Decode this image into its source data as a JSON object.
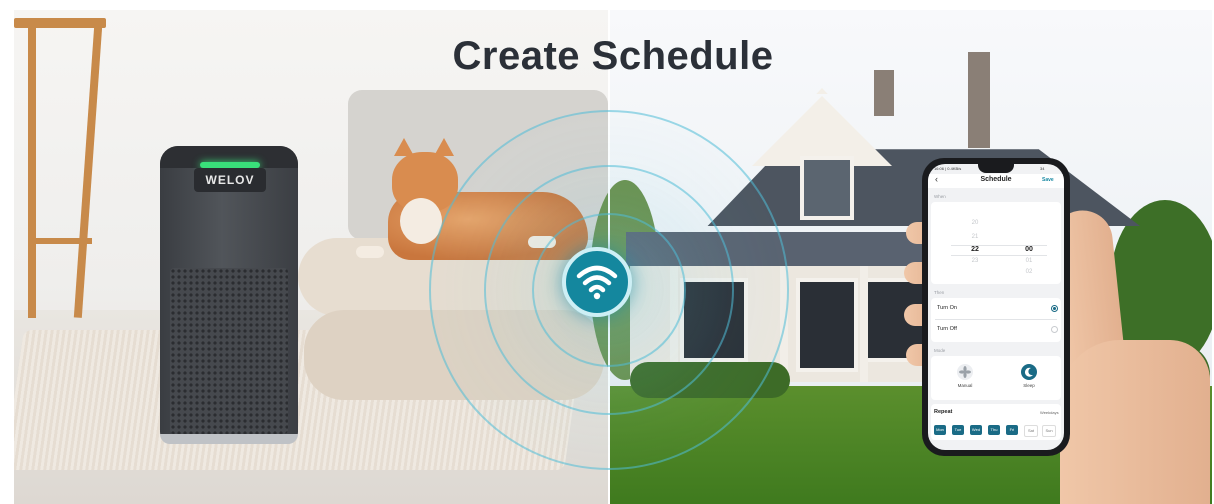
{
  "banner": {
    "title": "Create Schedule",
    "purifier_brand": "WELOV"
  },
  "phone": {
    "status_left": "16:06 | 0.4KB/s",
    "status_right": "34",
    "header": {
      "back_icon": "chevron-left-icon",
      "title": "Schedule",
      "save_label": "Save"
    },
    "when": {
      "label": "When",
      "hours": [
        "20",
        "21",
        "22",
        "23"
      ],
      "selected_hour": "22",
      "minutes": [
        "00",
        "01",
        "02"
      ],
      "selected_minute": "00"
    },
    "then": {
      "label": "Then",
      "options": [
        {
          "label": "Turn On",
          "selected": true
        },
        {
          "label": "Turn Off",
          "selected": false
        }
      ]
    },
    "mode": {
      "label": "Mode",
      "options": [
        {
          "label": "Manual",
          "icon": "fan-icon",
          "selected": false
        },
        {
          "label": "Sleep",
          "icon": "moon-icon",
          "selected": true
        }
      ]
    },
    "repeat": {
      "label": "Repeat",
      "summary": "Weekdays",
      "days": [
        {
          "label": "Mon",
          "selected": true
        },
        {
          "label": "Tue",
          "selected": true
        },
        {
          "label": "Wed",
          "selected": true
        },
        {
          "label": "Thu",
          "selected": true
        },
        {
          "label": "Fri",
          "selected": true
        },
        {
          "label": "Sat",
          "selected": false
        },
        {
          "label": "Sun",
          "selected": false
        }
      ]
    }
  },
  "colors": {
    "accent": "#1a6b86",
    "wifi_hub": "#14879e",
    "title_text": "#2b3038"
  }
}
